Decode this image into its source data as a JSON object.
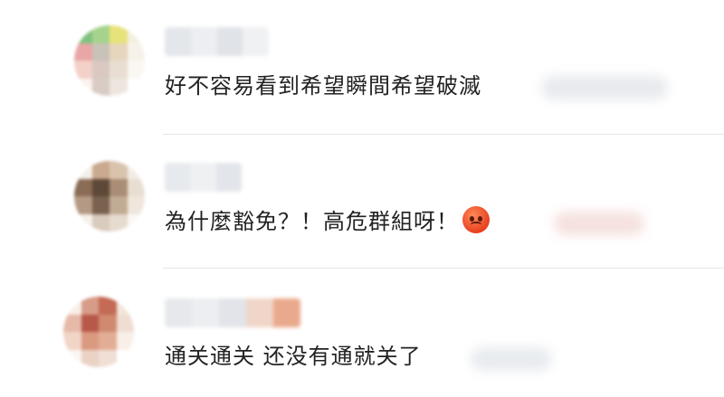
{
  "comments": [
    {
      "text": "好不容易看到希望瞬間希望破滅"
    },
    {
      "text": "為什麼豁免？！高危群組呀！",
      "emoji": "angry-face-emoji"
    },
    {
      "text": "通关通关 还没有通就关了"
    }
  ]
}
